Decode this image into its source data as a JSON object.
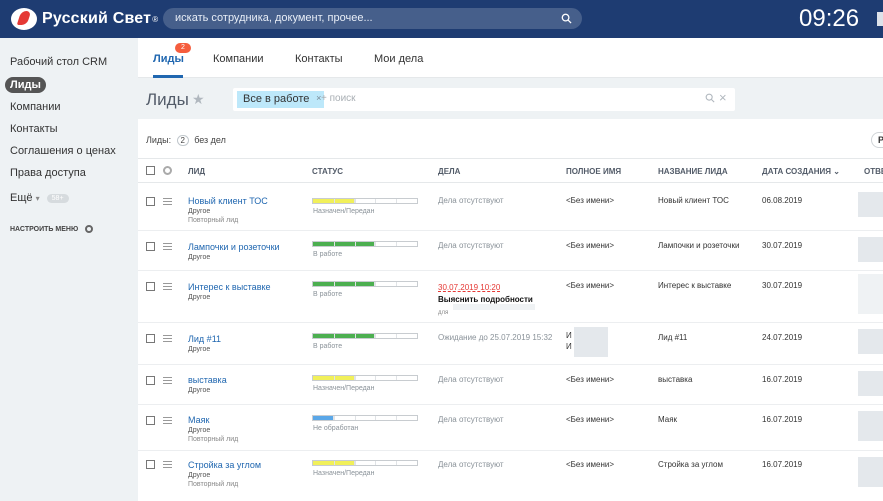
{
  "header": {
    "logo_text": "Русский Свет",
    "logo_reg": "®",
    "search_placeholder": "искать сотрудника, документ, прочее...",
    "clock": "09:26"
  },
  "sidebar": {
    "items": [
      {
        "label": "Рабочий стол CRM"
      },
      {
        "label": "Лиды"
      },
      {
        "label": "Компании"
      },
      {
        "label": "Контакты"
      },
      {
        "label": "Соглашения о ценах"
      },
      {
        "label": "Права доступа"
      }
    ],
    "more_label": "Ещё",
    "more_arrow": "▾",
    "more_badge": "58+",
    "config_label": "НАСТРОИТЬ МЕНЮ"
  },
  "tabs": [
    {
      "label": "Лиды",
      "badge": "2"
    },
    {
      "label": "Компании"
    },
    {
      "label": "Контакты"
    },
    {
      "label": "Мои дела"
    }
  ],
  "toolbar": {
    "title": "Лиды",
    "star": "★",
    "filter_chip": "Все в работе",
    "filter_chip_x": "×",
    "filter_placeholder": "+ поиск",
    "filter_close": "×"
  },
  "counter": {
    "prefix": "Лиды:",
    "count": "2",
    "suffix": "без дел",
    "right_button": "Р"
  },
  "table": {
    "columns": [
      "ЛИД",
      "СТАТУС",
      "ДЕЛА",
      "ПОЛНОЕ ИМЯ",
      "НАЗВАНИЕ ЛИДА",
      "ДАТА СОЗДАНИЯ",
      "ОТВЕ"
    ],
    "sort_arrow": "⌄",
    "rows": [
      {
        "name": "Новый клиент ТОС",
        "source": "Другое",
        "repeat": "Повторный лид",
        "status": "Назначен/Передан",
        "progress": 0.4,
        "color": "#f1f05a",
        "deal": "Дела отсутствуют",
        "full_name": "<Без имени>",
        "title": "Новый клиент ТОС",
        "date": "06.08.2019"
      },
      {
        "name": "Лампочки и розеточки",
        "source": "Другое",
        "repeat": "",
        "status": "В работе",
        "progress": 0.6,
        "color": "#4caf50",
        "deal": "Дела отсутствуют",
        "full_name": "<Без имени>",
        "title": "Лампочки и розеточки",
        "date": "30.07.2019"
      },
      {
        "name": "Интерес к выставке",
        "source": "Другое",
        "repeat": "",
        "status": "В работе",
        "progress": 0.6,
        "color": "#4caf50",
        "deal_date": "30.07.2019 10:20",
        "deal_title": "Выяснить подробности",
        "deal_for": "для",
        "full_name": "<Без имени>",
        "title": "Интерес к выставке",
        "date": "30.07.2019"
      },
      {
        "name": "Лид #11",
        "source": "Другое",
        "repeat": "",
        "status": "В работе",
        "progress": 0.6,
        "color": "#4caf50",
        "deal": "Ожидание до 25.07.2019 15:32",
        "full_name_a": "И",
        "full_name_b": "И",
        "title": "Лид #11",
        "date": "24.07.2019"
      },
      {
        "name": "выставка",
        "source": "Другое",
        "repeat": "",
        "status": "Назначен/Передан",
        "progress": 0.4,
        "color": "#f1f05a",
        "deal": "Дела отсутствуют",
        "full_name": "<Без имени>",
        "title": "выставка",
        "date": "16.07.2019"
      },
      {
        "name": "Маяк",
        "source": "Другое",
        "repeat": "Повторный лид",
        "status": "Не обработан",
        "progress": 0.2,
        "color": "#5aa7e8",
        "deal": "Дела отсутствуют",
        "full_name": "<Без имени>",
        "title": "Маяк",
        "date": "16.07.2019"
      },
      {
        "name": "Стройка за углом",
        "source": "Другое",
        "repeat": "Повторный лид",
        "status": "Назначен/Передан",
        "progress": 0.4,
        "color": "#f1f05a",
        "deal": "Дела отсутствуют",
        "full_name": "<Без имени>",
        "title": "Стройка за углом",
        "date": "16.07.2019"
      }
    ]
  }
}
